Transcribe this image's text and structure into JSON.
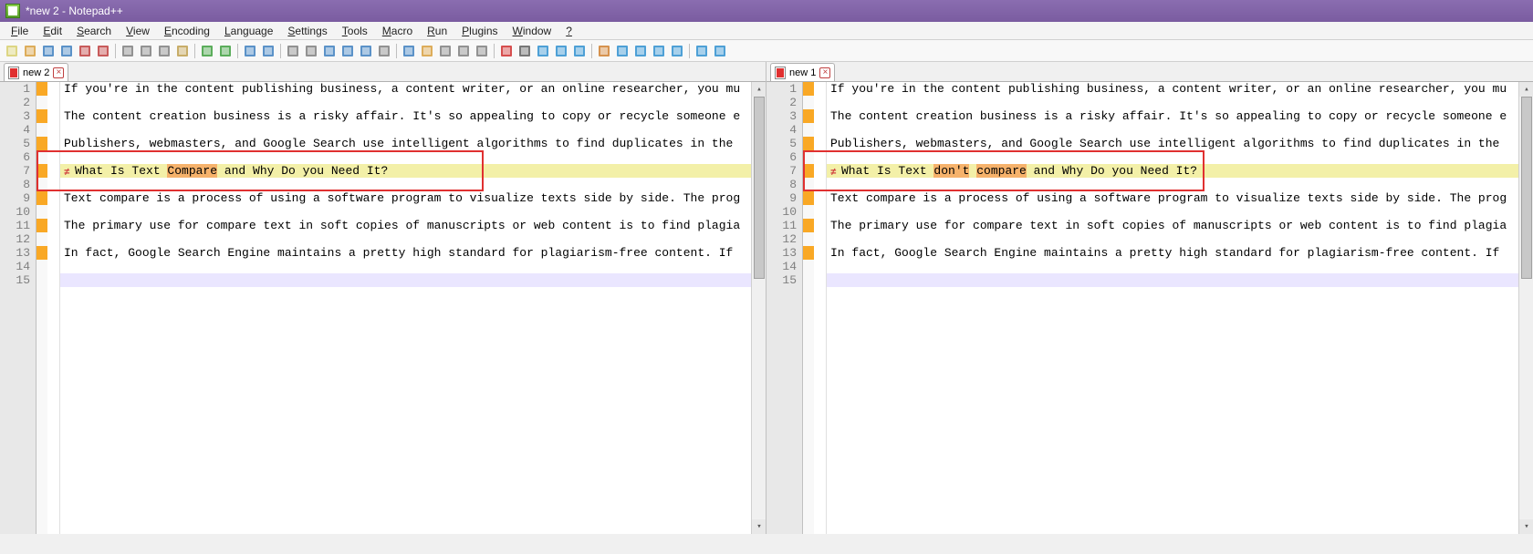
{
  "title": "*new 2 - Notepad++",
  "menus": [
    "File",
    "Edit",
    "Search",
    "View",
    "Encoding",
    "Language",
    "Settings",
    "Tools",
    "Macro",
    "Run",
    "Plugins",
    "Window",
    "?"
  ],
  "toolbar_icons": [
    "new",
    "open",
    "save",
    "save-all",
    "close",
    "close-all",
    "print",
    "cut",
    "copy",
    "paste",
    "undo",
    "redo",
    "find",
    "replace",
    "zoom-in",
    "zoom-out",
    "sync-v",
    "sync-h",
    "wrap",
    "show-all",
    "indent-guide",
    "folder",
    "doc-map",
    "func-list",
    "monitor",
    "record",
    "stop",
    "play",
    "play-multi",
    "save-macro",
    "compare-first",
    "compare-prev",
    "compare",
    "compare-next",
    "compare-last",
    "nav-prev",
    "nav-next"
  ],
  "left": {
    "tab_label": "new 2",
    "tab_dirty": true,
    "lines": [
      "If you're in the content publishing business, a content writer, or an online researcher, you mu",
      "",
      "The content creation business is a risky affair. It's so appealing to copy or recycle someone e",
      "",
      "Publishers, webmasters, and Google Search use intelligent algorithms to find duplicates in the ",
      "",
      "What Is Text Compare and Why Do you Need It?",
      "",
      "Text compare is a process of using a software program to visualize texts side by side. The prog",
      "",
      "The primary use for compare text in soft copies of manuscripts or web content is to find plagia",
      "",
      "In fact, Google Search Engine maintains a pretty high standard for plagiarism-free content. If ",
      "",
      ""
    ],
    "diff_line_index": 6,
    "diff_highlight_words": [
      {
        "start": 13,
        "end": 20
      }
    ],
    "change_rows": [
      0,
      2,
      4,
      6,
      8,
      10,
      12
    ],
    "red_box": {
      "top_line": 5,
      "bottom_line": 8
    }
  },
  "right": {
    "tab_label": "new 1",
    "tab_dirty": true,
    "lines": [
      "If you're in the content publishing business, a content writer, or an online researcher, you mu",
      "",
      "The content creation business is a risky affair. It's so appealing to copy or recycle someone e",
      "",
      "Publishers, webmasters, and Google Search use intelligent algorithms to find duplicates in the ",
      "",
      "What Is Text don't compare and Why Do you Need It?",
      "",
      "Text compare is a process of using a software program to visualize texts side by side. The prog",
      "",
      "The primary use for compare text in soft copies of manuscripts or web content is to find plagia",
      "",
      "In fact, Google Search Engine maintains a pretty high standard for plagiarism-free content. If ",
      "",
      ""
    ],
    "diff_line_index": 6,
    "diff_highlight_words": [
      {
        "start": 13,
        "end": 18
      },
      {
        "start": 19,
        "end": 26
      }
    ],
    "change_rows": [
      0,
      2,
      4,
      6,
      8,
      10,
      12
    ],
    "red_box": {
      "top_line": 5,
      "bottom_line": 8
    }
  }
}
